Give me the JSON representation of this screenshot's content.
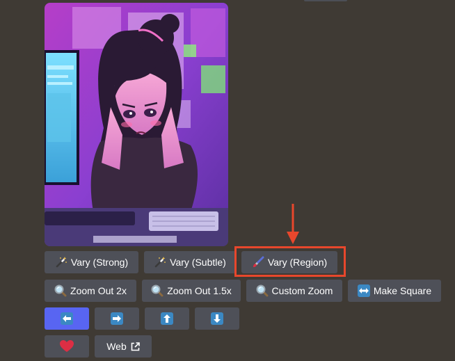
{
  "message": {
    "image_subject": "anime-girl-at-computer"
  },
  "buttons": {
    "row1": [
      {
        "label": "Vary (Strong)",
        "icon": "magic-wand-icon"
      },
      {
        "label": "Vary (Subtle)",
        "icon": "magic-wand-icon"
      },
      {
        "label": "Vary (Region)",
        "icon": "paintbrush-icon"
      }
    ],
    "row2": [
      {
        "label": "Zoom Out 2x",
        "icon": "magnifier-icon"
      },
      {
        "label": "Zoom Out 1.5x",
        "icon": "magnifier-icon"
      },
      {
        "label": "Custom Zoom",
        "icon": "magnifier-icon"
      },
      {
        "label": "Make Square",
        "icon": "left-right-arrow-icon"
      }
    ],
    "row3": [
      {
        "icon": "arrow-left-icon"
      },
      {
        "icon": "arrow-right-icon"
      },
      {
        "icon": "arrow-up-icon"
      },
      {
        "icon": "arrow-down-icon"
      }
    ],
    "row4": [
      {
        "icon": "heart-icon"
      },
      {
        "label": "Web",
        "icon": "external-link-icon"
      }
    ]
  },
  "annotation": {
    "highlight_color": "#e8472c",
    "highlighted": "Vary (Region)"
  },
  "colors": {
    "background": "#3f3a34",
    "button": "#4e5058",
    "primary_button": "#5865f2",
    "heart": "#dd2e44",
    "arrow_square": "#3b88c3"
  }
}
